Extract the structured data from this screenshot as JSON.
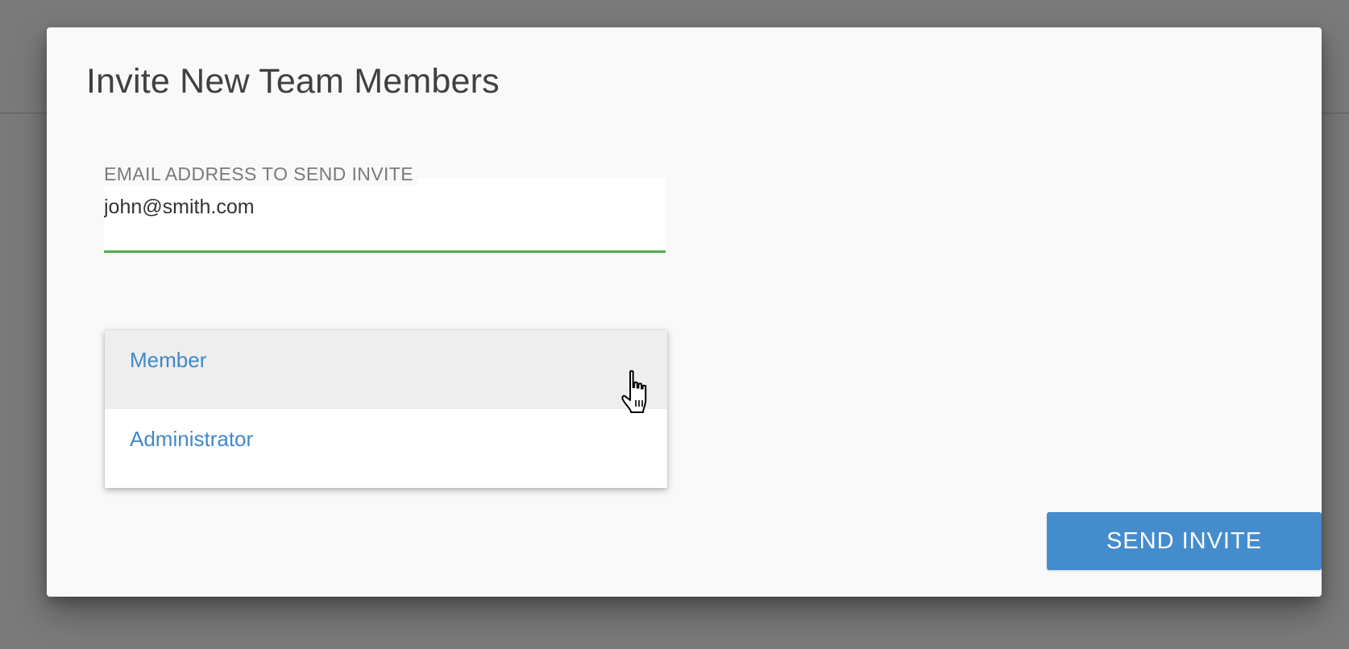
{
  "modal": {
    "title": "Invite New Team Members"
  },
  "email_field": {
    "label": "EMAIL ADDRESS TO SEND INVITE",
    "value": "john@smith.com",
    "focus_color": "#4cae4c"
  },
  "role_dropdown": {
    "options": [
      {
        "label": "Member",
        "hovered": true
      },
      {
        "label": "Administrator",
        "hovered": false
      }
    ],
    "option_color": "#4288c9"
  },
  "actions": {
    "send_label": "SEND INVITE",
    "button_color": "#458ccd"
  },
  "cursor": {
    "icon": "hand-pointer-icon"
  }
}
